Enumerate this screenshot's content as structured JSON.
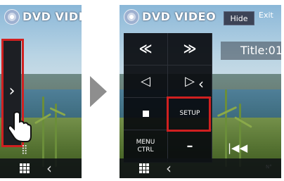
{
  "app_title": "DVD VIDEO",
  "header": {
    "hide_label": "Hide",
    "exit_label": "Exit"
  },
  "left_screen": {
    "side_tab_icon": "chevron-right-icon"
  },
  "right_screen": {
    "title_label": "Title:01",
    "controls": {
      "rewind": "≪",
      "fast_forward": "≫",
      "prev": "◁",
      "next": "▷",
      "stop_icon": "stop-icon",
      "setup": "SETUP",
      "menu_line1": "MENU",
      "menu_line2": "CTRL",
      "minus": "–"
    },
    "panel_collapse_icon": "chevron-left-icon",
    "skip_icon": "skip-back-icon",
    "n_label": "N°"
  },
  "colors": {
    "highlight": "#d02020",
    "panel": "#0a0c10"
  }
}
